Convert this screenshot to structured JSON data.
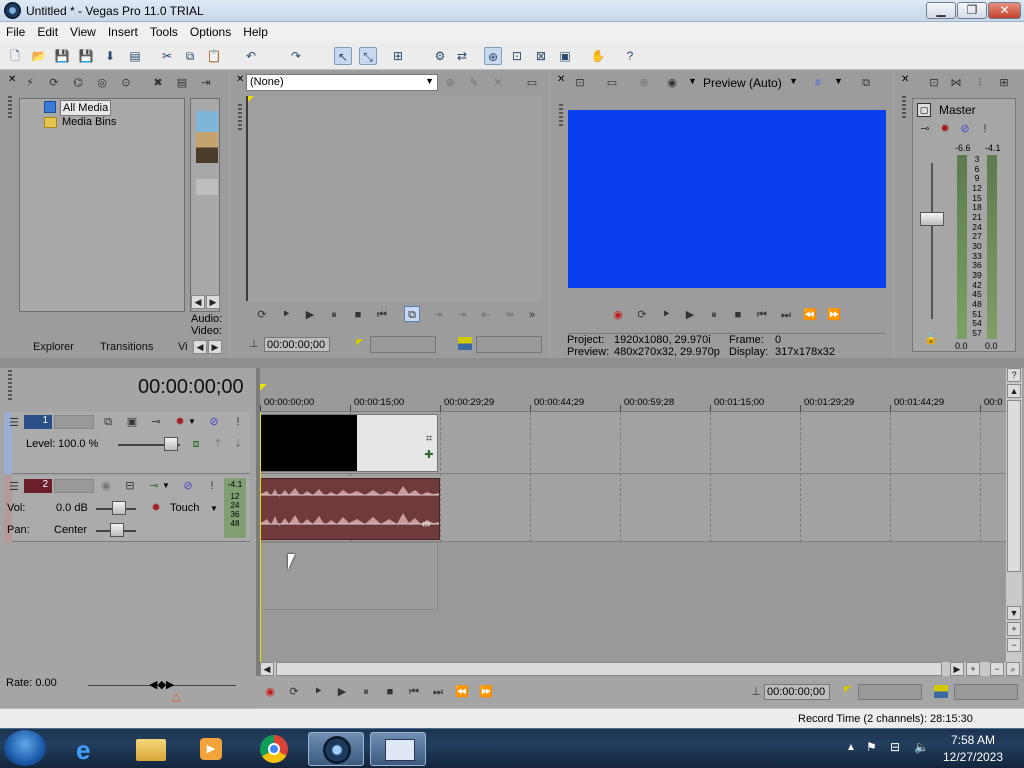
{
  "window": {
    "title": "Untitled * - Vegas Pro 11.0 TRIAL",
    "min": "▁",
    "max": "❐",
    "close": "✕"
  },
  "menu": [
    "File",
    "Edit",
    "View",
    "Insert",
    "Tools",
    "Options",
    "Help"
  ],
  "explorer": {
    "tree": [
      "All Media",
      "Media Bins"
    ],
    "tabs": [
      "Explorer",
      "Transitions",
      "Vi"
    ],
    "audio_label": "Audio:",
    "video_label": "Video:"
  },
  "trimmer": {
    "dropdown": "(None)",
    "timecode": "00:00:00;00"
  },
  "preview": {
    "mode": "Preview (Auto)",
    "project_label": "Project:",
    "project_value": "1920x1080, 29.970i",
    "frame_label": "Frame:",
    "frame_value": "0",
    "preview_label": "Preview:",
    "preview_value": "480x270x32, 29.970p",
    "display_label": "Display:",
    "display_value": "317x178x32",
    "video_color": "#0a3ff0"
  },
  "master": {
    "label": "Master",
    "peak_left": "-6.6",
    "peak_right": "-4.1",
    "scale": [
      "3",
      "6",
      "9",
      "12",
      "15",
      "18",
      "21",
      "24",
      "27",
      "30",
      "33",
      "36",
      "39",
      "42",
      "45",
      "48",
      "51",
      "54",
      "57"
    ],
    "bottom_left": "0.0",
    "bottom_right": "0.0"
  },
  "timeline": {
    "timecode": "00:00:00;00",
    "ruler": [
      "00:00:00;00",
      "00:00:15;00",
      "00:00:29;29",
      "00:00:44;29",
      "00:00:59;28",
      "00:01:15;00",
      "00:01:29;29",
      "00:01:44;29",
      "00:0"
    ],
    "video_track": {
      "number": "1",
      "level_label": "Level:",
      "level_value": "100.0 %"
    },
    "audio_track": {
      "number": "2",
      "vol_label": "Vol:",
      "vol_value": "0.0 dB",
      "pan_label": "Pan:",
      "pan_value": "Center",
      "mode": "Touch",
      "meter_peak": "-4.1",
      "meter_scale": [
        "12",
        "24",
        "36",
        "48"
      ]
    },
    "rate": "Rate: 0.00",
    "bottom_timecode": "00:00:00;00",
    "record_time": "Record Time (2 channels): 28:15:30"
  },
  "taskbar": {
    "time": "7:58 AM",
    "date": "12/27/2023"
  }
}
